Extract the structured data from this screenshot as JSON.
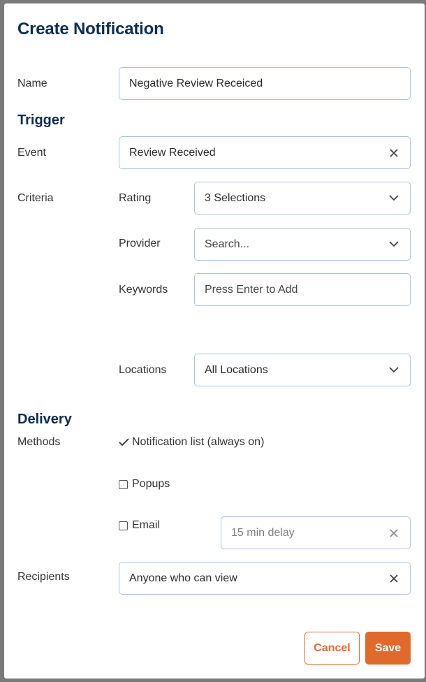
{
  "modal": {
    "title": "Create Notification"
  },
  "name": {
    "label": "Name",
    "value": "Negative Review Receiced"
  },
  "trigger": {
    "title": "Trigger",
    "event_label": "Event",
    "event_value": "Review Received",
    "criteria_label": "Criteria",
    "rating_label": "Rating",
    "rating_value": "3 Selections",
    "provider_label": "Provider",
    "provider_placeholder": "Search...",
    "keywords_label": "Keywords",
    "keywords_placeholder": "Press Enter to Add",
    "locations_label": "Locations",
    "locations_value": "All Locations"
  },
  "delivery": {
    "title": "Delivery",
    "methods_label": "Methods",
    "notification_list": "Notification list (always on)",
    "popups": "Popups",
    "email": "Email",
    "email_delay": "15 min delay",
    "recipients_label": "Recipients",
    "recipients_value": "Anyone who can view"
  },
  "actions": {
    "cancel": "Cancel",
    "save": "Save"
  },
  "colors": {
    "heading": "#0f2d52",
    "accent": "#e06a2c",
    "field_border": "#a9c2e8",
    "overlay": "#7a7a7a"
  }
}
